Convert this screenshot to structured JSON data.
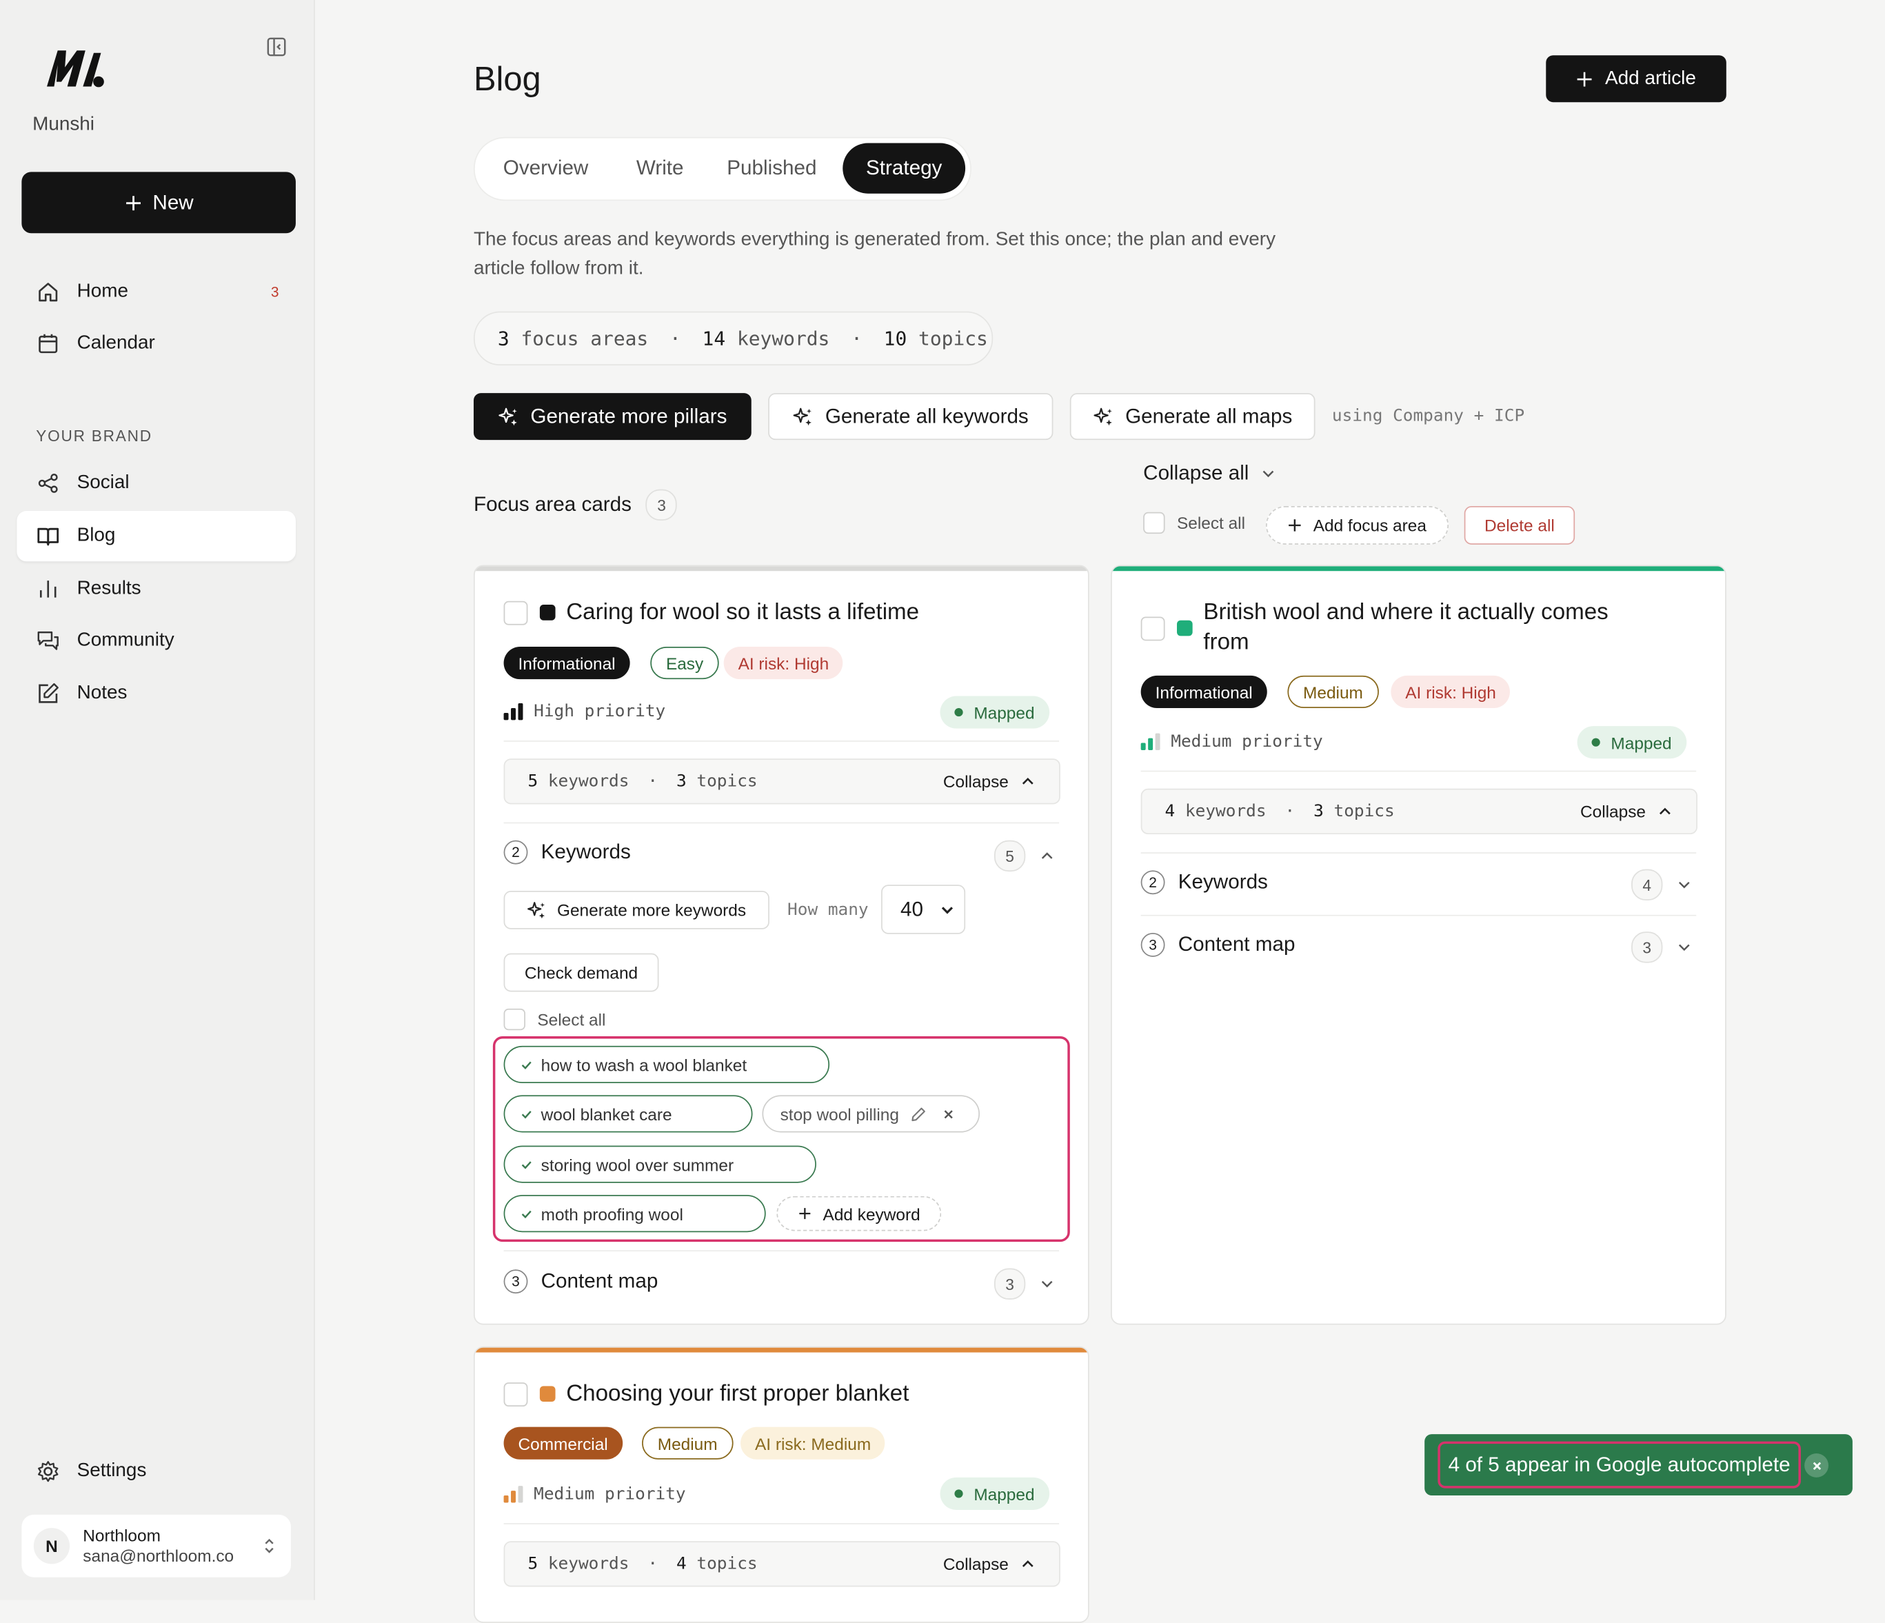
{
  "sidebar": {
    "brand": "Munshi",
    "new_label": "New",
    "nav_main": [
      {
        "label": "Home",
        "badge": "3",
        "icon": "home-icon"
      },
      {
        "label": "Calendar",
        "icon": "calendar-icon"
      }
    ],
    "section_label": "YOUR BRAND",
    "nav_brand": [
      {
        "label": "Social",
        "icon": "share-icon"
      },
      {
        "label": "Blog",
        "icon": "book-icon",
        "active": true
      },
      {
        "label": "Results",
        "icon": "bar-chart-icon"
      },
      {
        "label": "Community",
        "icon": "chat-icon"
      },
      {
        "label": "Notes",
        "icon": "edit-icon"
      }
    ],
    "settings_label": "Settings",
    "account": {
      "initial": "N",
      "name": "Northloom",
      "email": "sana@northloom.co"
    }
  },
  "header": {
    "title": "Blog",
    "add_article_label": "Add article"
  },
  "tabs": [
    {
      "label": "Overview"
    },
    {
      "label": "Write"
    },
    {
      "label": "Published"
    },
    {
      "label": "Strategy",
      "active": true
    }
  ],
  "description": "The focus areas and keywords everything is generated from. Set this once; the plan and every article follow from it.",
  "stats": {
    "focus_areas": "3",
    "focus_areas_label": "focus areas",
    "keywords": "14",
    "keywords_label": "keywords",
    "topics": "10",
    "topics_label": "topics",
    "sep": "·"
  },
  "actions": {
    "generate_pillars": "Generate more pillars",
    "generate_keywords": "Generate all keywords",
    "generate_maps": "Generate all maps",
    "using_note": "using Company + ICP"
  },
  "toolbar": {
    "collapse_all": "Collapse all",
    "focus_label": "Focus area cards",
    "focus_count": "3",
    "select_all": "Select all",
    "add_focus_area": "Add focus area",
    "delete_all": "Delete all"
  },
  "cards": [
    {
      "title": "Caring for wool so it lasts a lifetime",
      "intent": "Informational",
      "difficulty": "Easy",
      "ai_risk": "AI risk: High",
      "priority": "High priority",
      "status": "Mapped",
      "summary": {
        "keywords": "5",
        "keywords_label": "keywords",
        "topics": "3",
        "topics_label": "topics",
        "collapse": "Collapse"
      },
      "keywords_section": {
        "num": "2",
        "label": "Keywords",
        "count": "5"
      },
      "generate_more_keywords": "Generate more keywords",
      "how_many_label": "How many",
      "how_many_value": "40",
      "check_demand": "Check demand",
      "select_all": "Select all",
      "keywords": [
        "how to wash a wool blanket",
        "wool blanket care",
        "stop wool pilling",
        "storing wool over summer",
        "moth proofing wool"
      ],
      "add_keyword": "Add keyword",
      "content_map": {
        "num": "3",
        "label": "Content map",
        "count": "3"
      },
      "accent": "#d9d9d7"
    },
    {
      "title": "British wool and where it actually comes from",
      "intent": "Informational",
      "difficulty": "Medium",
      "ai_risk": "AI risk: High",
      "priority": "Medium priority",
      "status": "Mapped",
      "summary": {
        "keywords": "4",
        "keywords_label": "keywords",
        "topics": "3",
        "topics_label": "topics",
        "collapse": "Collapse"
      },
      "keywords_section": {
        "num": "2",
        "label": "Keywords",
        "count": "4"
      },
      "content_map": {
        "num": "3",
        "label": "Content map",
        "count": "3"
      },
      "accent": "#1fae7a"
    },
    {
      "title": "Choosing your first proper blanket",
      "intent": "Commercial",
      "difficulty": "Medium",
      "ai_risk": "AI risk: Medium",
      "priority": "Medium priority",
      "status": "Mapped",
      "summary": {
        "keywords": "5",
        "keywords_label": "keywords",
        "topics": "4",
        "topics_label": "topics",
        "collapse": "Collapse"
      },
      "accent": "#e08a3c"
    }
  ],
  "toast": {
    "message": "4 of 5 appear in Google autocomplete"
  }
}
